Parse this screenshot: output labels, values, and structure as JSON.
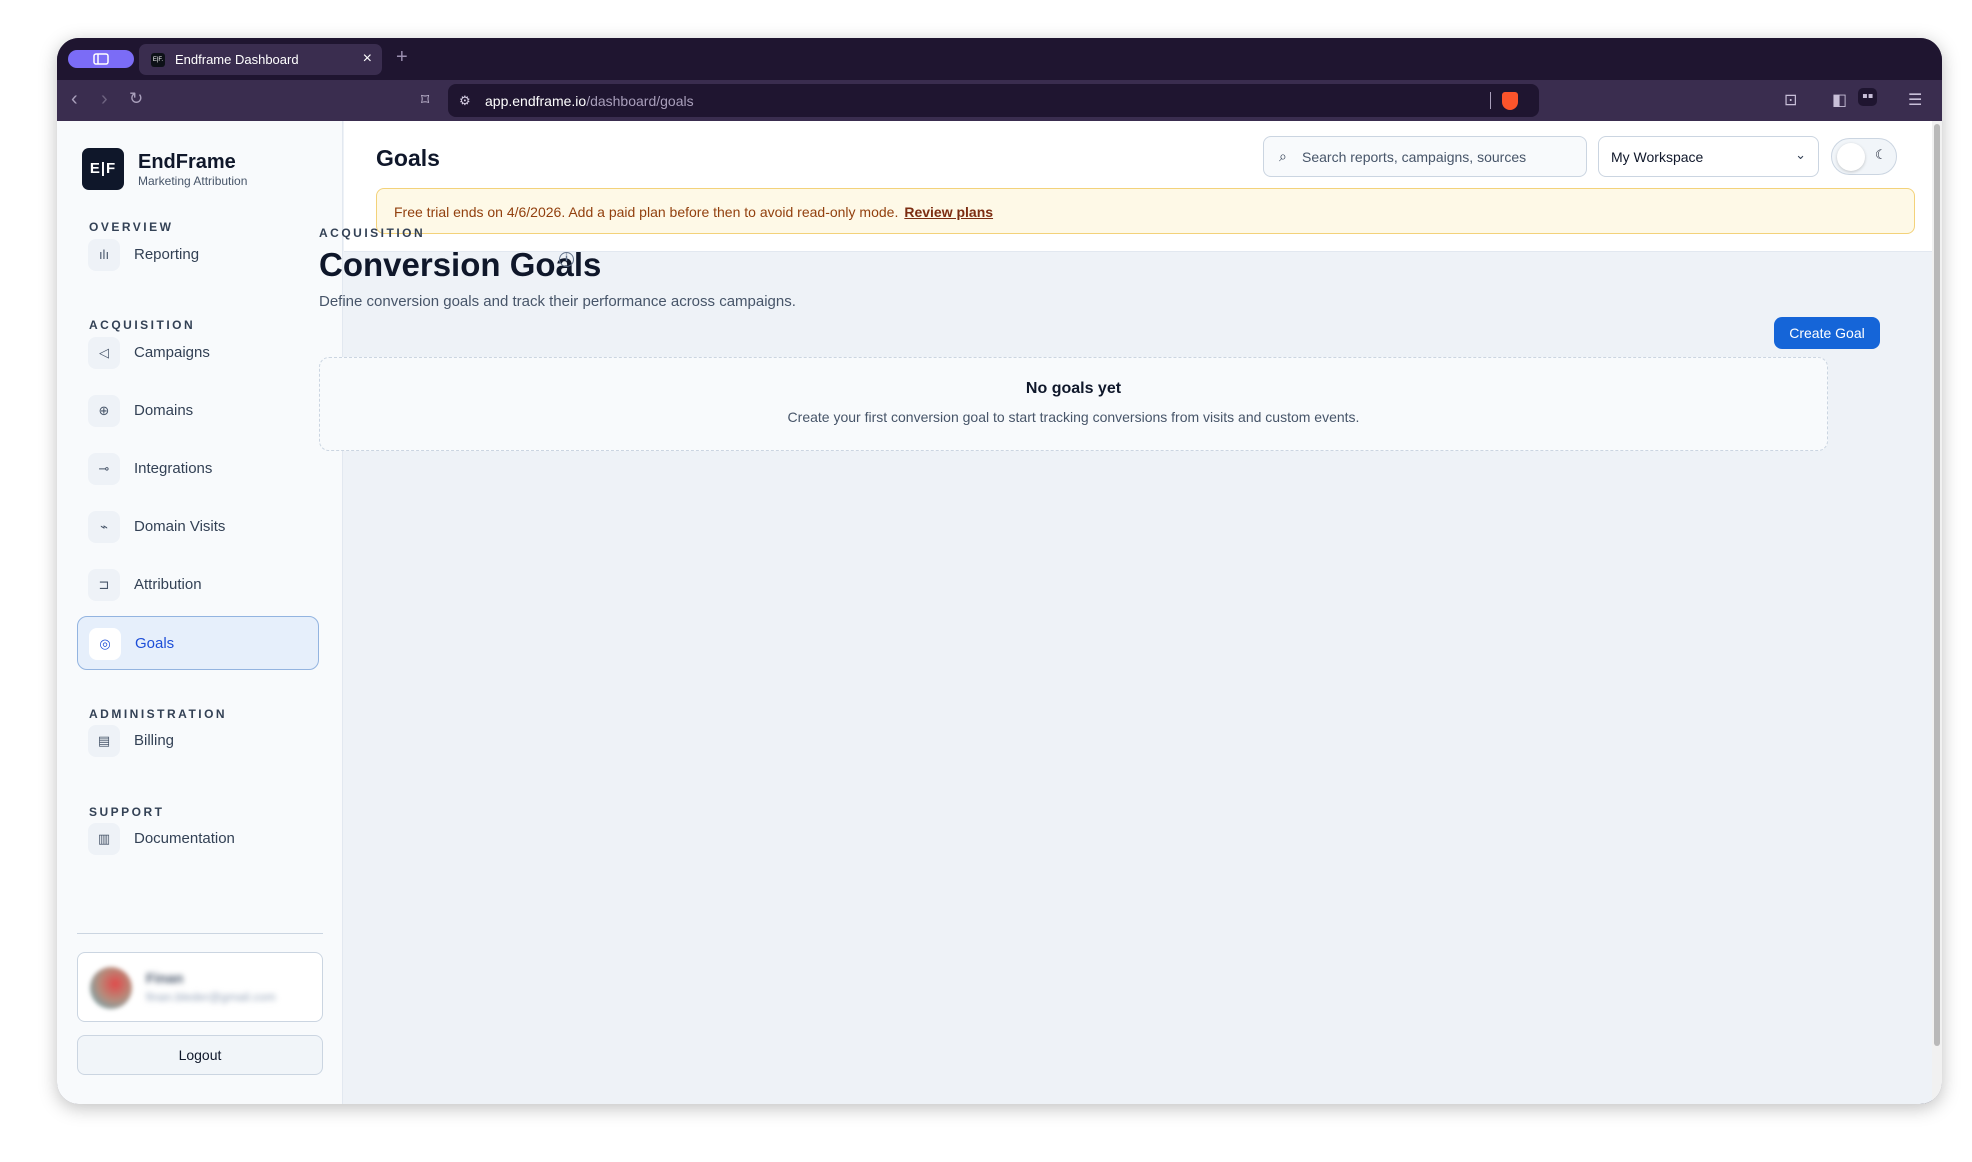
{
  "browser": {
    "tab_title": "Endframe Dashboard",
    "tab_favicon": "E|F.",
    "new_tab": "+",
    "close_tab": "×",
    "url_host": "app.endframe.io",
    "url_path": "/dashboard/goals"
  },
  "brand": {
    "logo": "E|F",
    "name": "EndFrame",
    "tagline": "Marketing Attribution"
  },
  "sidebar": {
    "sections": {
      "overview": "OVERVIEW",
      "acquisition": "ACQUISITION",
      "administration": "ADMINISTRATION",
      "support": "SUPPORT"
    },
    "items": [
      {
        "label": "Reporting",
        "icon": "bar-chart-icon"
      },
      {
        "label": "Campaigns",
        "icon": "megaphone-icon"
      },
      {
        "label": "Domains",
        "icon": "globe-icon"
      },
      {
        "label": "Integrations",
        "icon": "plug-icon"
      },
      {
        "label": "Domain Visits",
        "icon": "activity-icon"
      },
      {
        "label": "Attribution",
        "icon": "split-icon"
      },
      {
        "label": "Goals",
        "icon": "target-icon",
        "active": true
      },
      {
        "label": "Billing",
        "icon": "receipt-icon"
      },
      {
        "label": "Documentation",
        "icon": "document-icon"
      }
    ],
    "user": {
      "name": "Finan",
      "email": "finan.bleder@gmail.com"
    },
    "logout": "Logout"
  },
  "header": {
    "title": "Goals",
    "search_placeholder": "Search reports, campaigns, sources",
    "workspace": "My Workspace"
  },
  "banner": {
    "message": "Free trial ends on 4/6/2026. Add a paid plan before then to avoid read-only mode.",
    "link": "Review plans"
  },
  "main": {
    "eyebrow": "ACQUISITION",
    "title": "Conversion Goals",
    "subtitle": "Define conversion goals and track their performance across campaigns.",
    "create_button": "Create Goal",
    "empty_title": "No goals yet",
    "empty_desc": "Create your first conversion goal to start tracking conversions from visits and custom events."
  },
  "colors": {
    "accent": "#1565d8",
    "banner_bg": "#fef9e7",
    "banner_text": "#92400e",
    "browser_frame": "#1f1530"
  }
}
